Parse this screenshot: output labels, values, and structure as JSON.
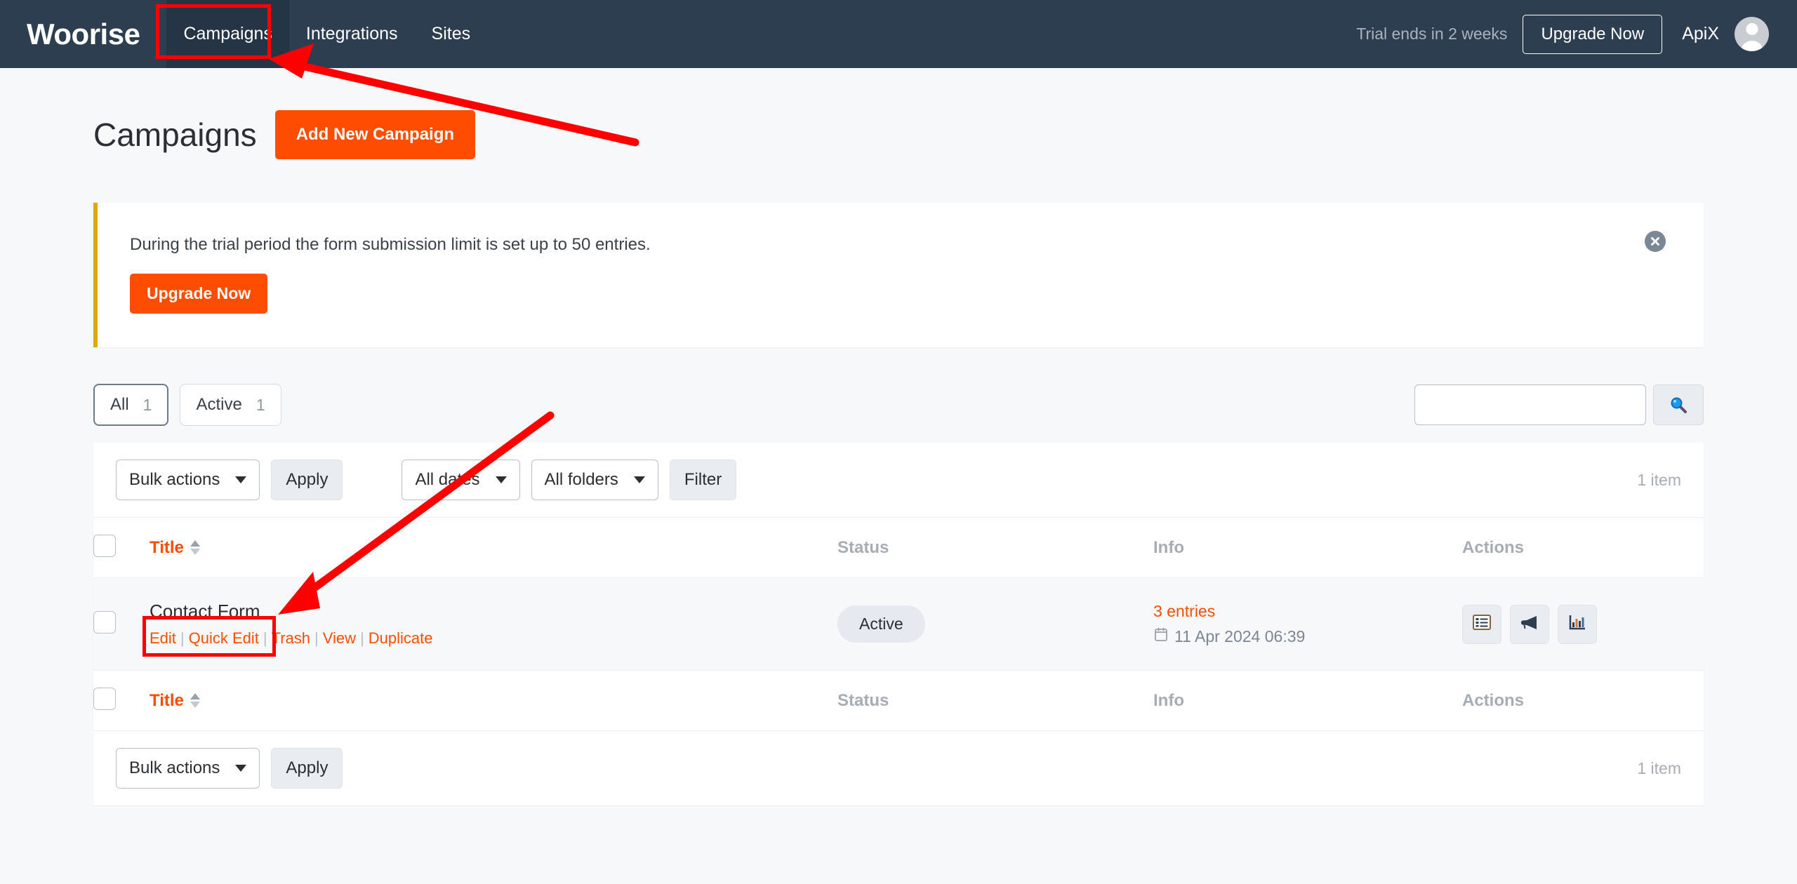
{
  "header": {
    "brand": "Woorise",
    "nav": [
      {
        "label": "Campaigns",
        "active": true
      },
      {
        "label": "Integrations",
        "active": false
      },
      {
        "label": "Sites",
        "active": false
      }
    ],
    "trial_text": "Trial ends in 2 weeks",
    "upgrade_label": "Upgrade Now",
    "user_name": "ApiX",
    "avatar_icon": "user-avatar-icon"
  },
  "page": {
    "title": "Campaigns",
    "add_button": "Add New Campaign"
  },
  "notice": {
    "text": "During the trial period the form submission limit is set up to 50 entries.",
    "button": "Upgrade Now",
    "close_icon": "close-circle-icon",
    "accent_color": "#e0a800"
  },
  "filters": {
    "tabs": [
      {
        "label": "All",
        "count": "1",
        "selected": true
      },
      {
        "label": "Active",
        "count": "1",
        "selected": false
      }
    ],
    "search_value": "",
    "search_placeholder": "",
    "search_icon": "search-icon"
  },
  "toolbar_top": {
    "bulk_actions": "Bulk actions",
    "apply": "Apply",
    "dates": "All dates",
    "folders": "All folders",
    "filter": "Filter",
    "item_count": "1 item"
  },
  "toolbar_bottom": {
    "bulk_actions": "Bulk actions",
    "apply": "Apply",
    "item_count": "1 item"
  },
  "table": {
    "columns": {
      "title": "Title",
      "status": "Status",
      "info": "Info",
      "actions": "Actions"
    },
    "rows": [
      {
        "title": "Contact Form",
        "row_actions": [
          "Edit",
          "Quick Edit",
          "Trash",
          "View",
          "Duplicate"
        ],
        "status": "Active",
        "entries": "3 entries",
        "date": "11 Apr 2024 06:39",
        "date_icon": "calendar-icon",
        "action_buttons": [
          {
            "icon": "entries-list-icon",
            "name": "view-entries-button"
          },
          {
            "icon": "megaphone-icon",
            "name": "promote-button"
          },
          {
            "icon": "bar-chart-icon",
            "name": "stats-button"
          }
        ]
      }
    ]
  },
  "colors": {
    "brand_orange": "#ff4d00",
    "nav_dark": "#2d3e50",
    "annotation_red": "#ff0000",
    "notice_accent": "#e0a800"
  }
}
